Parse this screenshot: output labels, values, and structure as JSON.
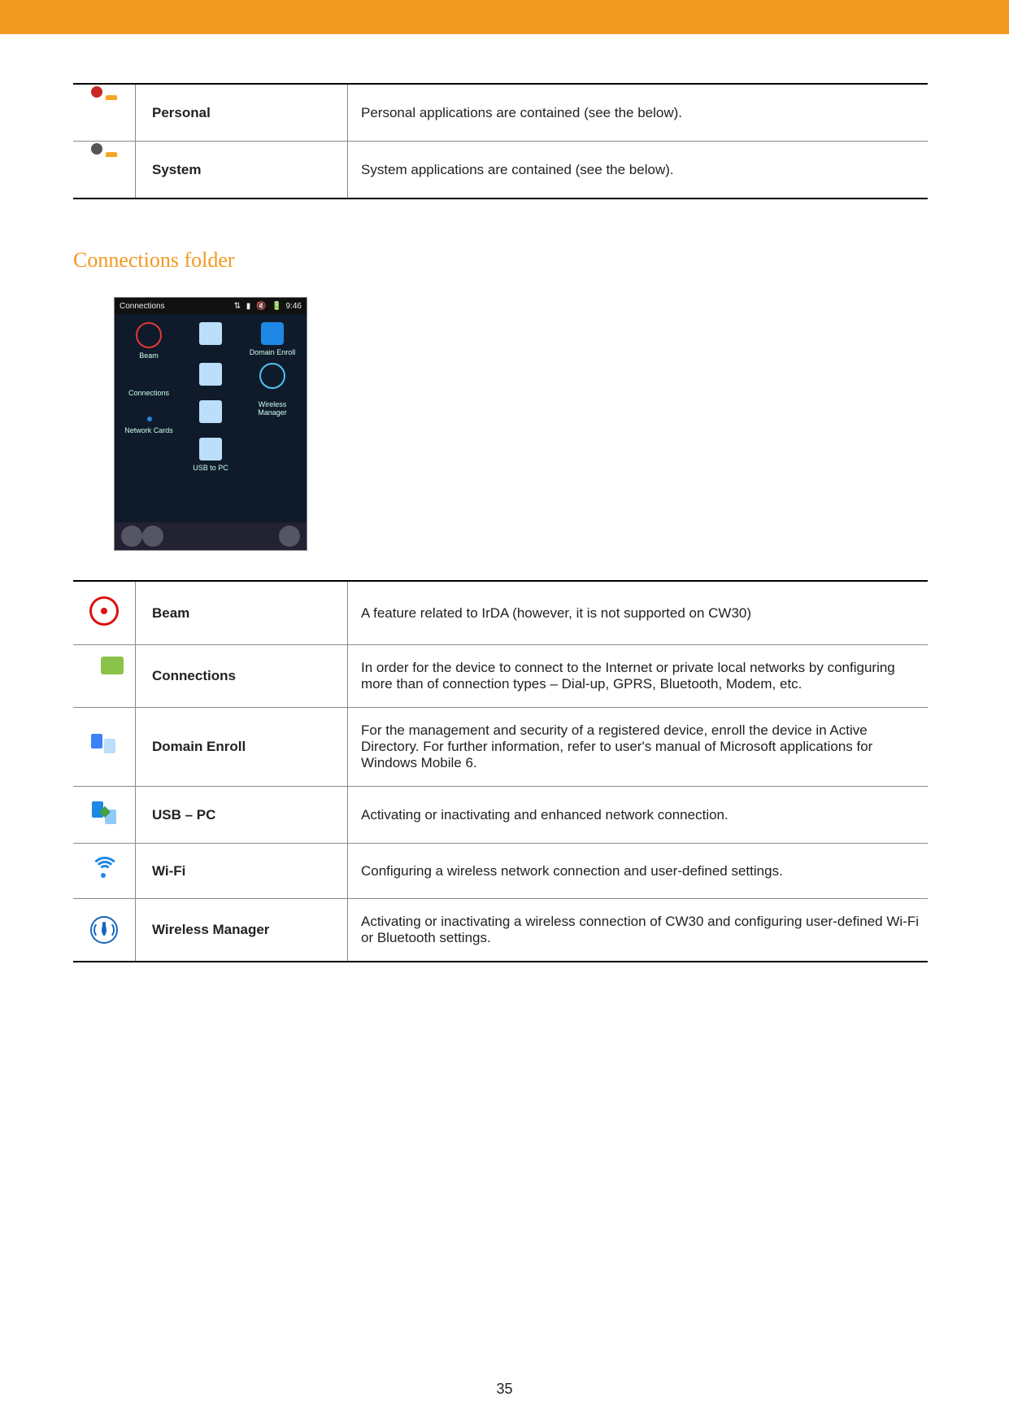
{
  "page_number": "35",
  "section_title": "Connections folder",
  "table_top": [
    {
      "name": "Personal",
      "desc": "Personal applications are contained (see the below).",
      "icon": "folder-personal-icon"
    },
    {
      "name": "System",
      "desc": "System applications are contained (see the below).",
      "icon": "folder-system-icon"
    }
  ],
  "screenshot": {
    "title": "Connections",
    "time": "9:46",
    "icons": [
      {
        "label": "Beam"
      },
      {
        "label": ""
      },
      {
        "label": "Domain Enroll"
      },
      {
        "label": ""
      },
      {
        "label": "Connections"
      },
      {
        "label": ""
      },
      {
        "label": "Network Cards"
      },
      {
        "label": ""
      },
      {
        "label": "Wireless Manager"
      },
      {
        "label": ""
      },
      {
        "label": "USB to PC"
      },
      {
        "label": ""
      }
    ]
  },
  "table_conn": [
    {
      "name": "Beam",
      "desc": "A feature related to IrDA (however, it is not supported on CW30)",
      "icon": "beam-icon"
    },
    {
      "name": "Connections",
      "desc": "In order for the device to connect to the Internet or private local networks by configuring more than of connection types – Dial-up, GPRS, Bluetooth, Modem, etc.",
      "icon": "connections-icon"
    },
    {
      "name": "Domain Enroll",
      "desc": "For the management and security of a registered device, enroll the device in Active Directory. For further information, refer to user's manual of Microsoft applications for Windows Mobile 6.",
      "icon": "domain-enroll-icon"
    },
    {
      "name": "USB – PC",
      "desc": "Activating or inactivating and enhanced network connection.",
      "icon": "usb-pc-icon"
    },
    {
      "name": "Wi-Fi",
      "desc": "Configuring a wireless network connection and user-defined settings.",
      "icon": "wifi-icon"
    },
    {
      "name": "Wireless Manager",
      "desc": "Activating or inactivating a wireless connection of CW30 and configuring user-defined Wi-Fi or Bluetooth settings.",
      "icon": "wireless-manager-icon"
    }
  ]
}
